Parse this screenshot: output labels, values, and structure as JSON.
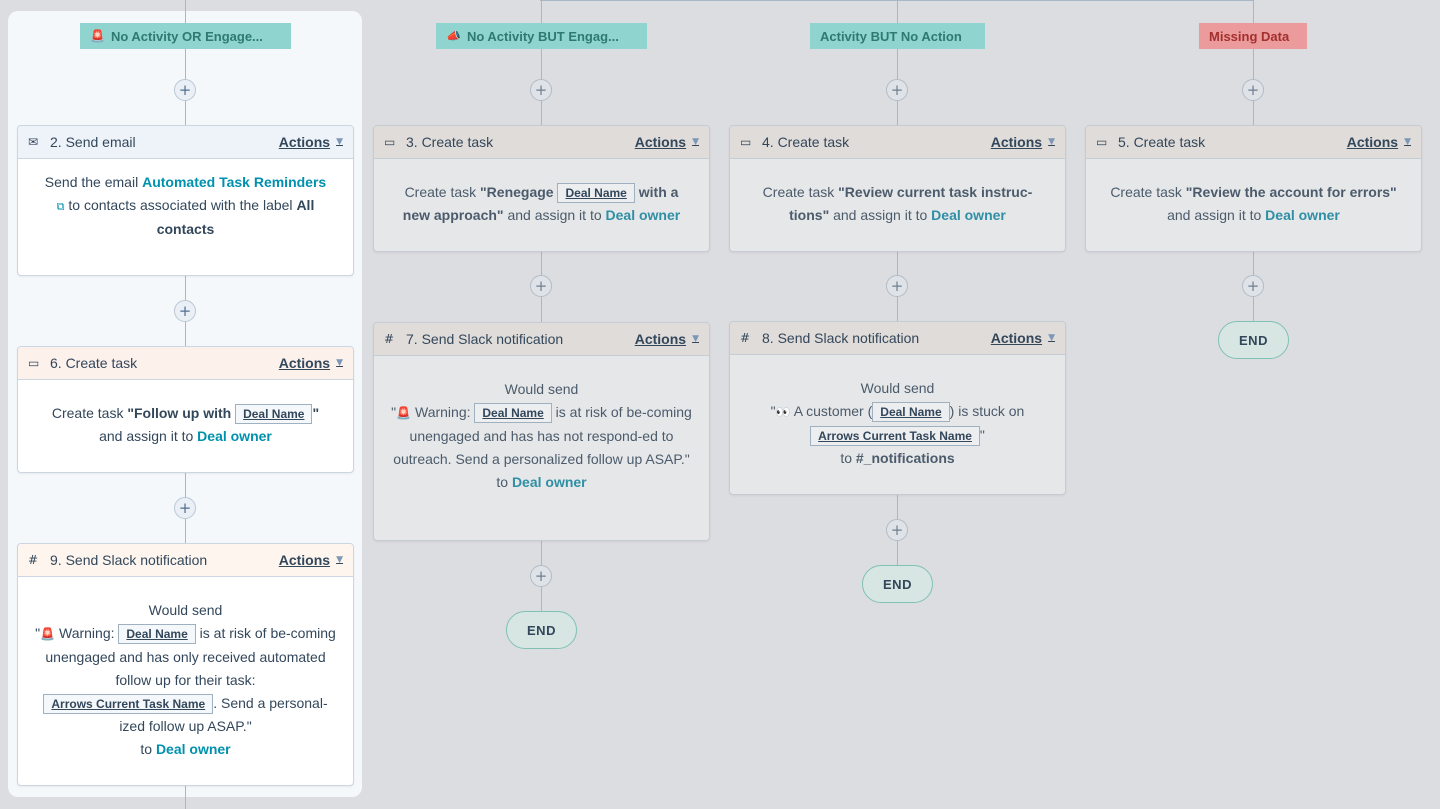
{
  "branches": [
    {
      "label": "No Activity OR Engage...",
      "emoji": "🚨",
      "color": "#8fd4cf"
    },
    {
      "label": "No Activity BUT Engag...",
      "emoji": "📣",
      "color": "#8fd4cf"
    },
    {
      "label": "Activity BUT No Action",
      "emoji": "",
      "color": "#8fd4cf"
    },
    {
      "label": "Missing Data",
      "emoji": "",
      "color": "#eb9b9b"
    }
  ],
  "actions_label": "Actions",
  "plus_symbol": "+",
  "end_label": "END",
  "icons": {
    "email": "email-icon",
    "task": "task-icon",
    "slack": "slack-icon",
    "external_link": "external-link-icon"
  },
  "cards": {
    "c2": {
      "title": "2. Send email",
      "t1": "Send the email ",
      "email_name": "Automated Task Reminders",
      "t2": " to contacts associated with the label ",
      "label_name": "All contacts"
    },
    "c6": {
      "title": "6. Create task",
      "t1": "Create task ",
      "q1": "\"Follow up with ",
      "token": "Deal Name",
      "q2": "\"",
      "t2": " and assign it to ",
      "owner": "Deal owner"
    },
    "c9": {
      "title": "9. Send Slack notification",
      "would": "Would send",
      "q_open": "\"",
      "emoji": "🚨",
      "t1": " Warning: ",
      "token1": "Deal Name",
      "t2": " is at risk of be-coming unengaged and has only received automated follow up for their task: ",
      "token2": "Arrows Current Task Name",
      "t3": ". Send a personal-ized follow up ASAP.\"",
      "to": "to ",
      "owner": "Deal owner"
    },
    "c3": {
      "title": "3. Create task",
      "t1": "Create task ",
      "q1": "\"Renegage ",
      "token": "Deal Name",
      "q2": " with a new approach\"",
      "t2": " and assign it to ",
      "owner": "Deal owner"
    },
    "c7": {
      "title": "7. Send Slack notification",
      "would": "Would send",
      "q_open": "\"",
      "emoji": "🚨",
      "t1": " Warning: ",
      "token1": "Deal Name",
      "t2": " is at risk of be-coming unengaged and has has not respond-ed to outreach. Send a personalized follow up ASAP.\"",
      "to": "to ",
      "owner": "Deal owner"
    },
    "c4": {
      "title": "4. Create task",
      "t1": "Create task ",
      "q1": "\"Review current task instruc-tions\"",
      "t2": " and assign it to ",
      "owner": "Deal owner"
    },
    "c8": {
      "title": "8. Send Slack notification",
      "would": "Would send",
      "q_open": "\"",
      "emoji": "👀",
      "t1": " A customer (",
      "token1": "Deal Name",
      "t2": ") is stuck on ",
      "token2": "Arrows Current Task Name",
      "t3": "\"",
      "to": "to ",
      "channel": "#_notifications"
    },
    "c5": {
      "title": "5. Create task",
      "t1": "Create task ",
      "q1": "\"Review the account for errors\"",
      "t2": " and assign it to ",
      "owner": "Deal owner"
    }
  }
}
